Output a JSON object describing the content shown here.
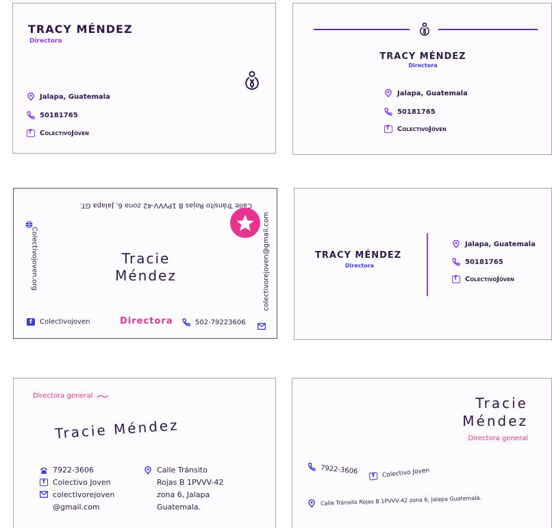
{
  "card1": {
    "name": "TRACY MÉNDEZ",
    "role": "Directora",
    "location": "Jalapa, Guatemala",
    "phone": "50181765",
    "social": "ColectivoJóven"
  },
  "card2": {
    "name": "TRACY MÉNDEZ",
    "role": "Directora",
    "location": "Jalapa, Guatemala",
    "phone": "50181765",
    "social": "ColectivoJóven"
  },
  "card3": {
    "address": "Calle Tránsito Rojas B 1PVVV-42 zona 6, Jalapa GT.",
    "website": "Colectivojoven.org",
    "email": "colectivorejoven@gmail.com",
    "name_line1": "Tracie",
    "name_line2": "Méndez",
    "role": "Directora",
    "social": "Colectivojoven",
    "phone": "502-79223606"
  },
  "card4": {
    "name": "TRACY MÉNDEZ",
    "role": "Directora",
    "location": "Jalapa, Guatemala",
    "phone": "50181765",
    "social": "ColectivoJóven"
  },
  "card5": {
    "role": "Directora general",
    "name": "Tracie Méndez",
    "phone": "7922-3606",
    "social": "Colectivo Joven",
    "email_line1": "colectivorejoven",
    "email_line2": "@gmail.com",
    "address_line1": "Calle Tránsito",
    "address_line2": "Rojas B 1PVVV-42",
    "address_line3": "zona 6, Jalapa",
    "address_line4": "Guatemala."
  },
  "card6": {
    "name_line1": "Tracie",
    "name_line2": "Méndez",
    "role": "Directora general",
    "phone": "7922-3606",
    "social": "Colectivo Joven",
    "address": "Calle Tránsito Rojas B 1PVVV-42 zona 6, Jalapa Guatemala."
  },
  "colors": {
    "purple": "#8a3cff",
    "dark": "#2a1a4a",
    "pink": "#e8338f",
    "blue": "#3a3cdc"
  }
}
